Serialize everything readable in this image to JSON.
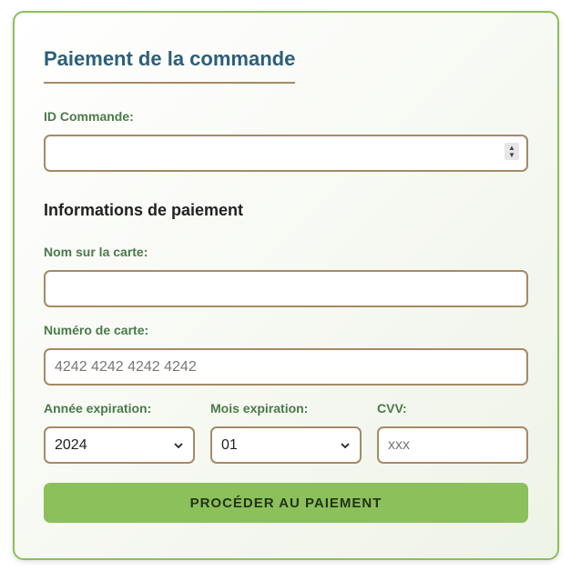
{
  "form": {
    "title": "Paiement de la commande",
    "order_id": {
      "label": "ID Commande:",
      "value": ""
    },
    "payment_section_title": "Informations de paiement",
    "card_name": {
      "label": "Nom sur la carte:",
      "value": ""
    },
    "card_number": {
      "label": "Numéro de carte:",
      "placeholder": "4242 4242 4242 4242"
    },
    "exp_year": {
      "label": "Année expiration:",
      "selected": "2024"
    },
    "exp_month": {
      "label": "Mois expiration:",
      "selected": "01"
    },
    "cvv": {
      "label": "CVV:",
      "placeholder": "xxx"
    },
    "submit_label": "Procéder au paiement"
  },
  "colors": {
    "accent": "#8bc05a",
    "title": "#2c5f7a",
    "label": "#4a7a4a",
    "border": "#a68a64"
  },
  "icons": [
    "spinner-arrows-icon",
    "chevron-down-icon"
  ]
}
